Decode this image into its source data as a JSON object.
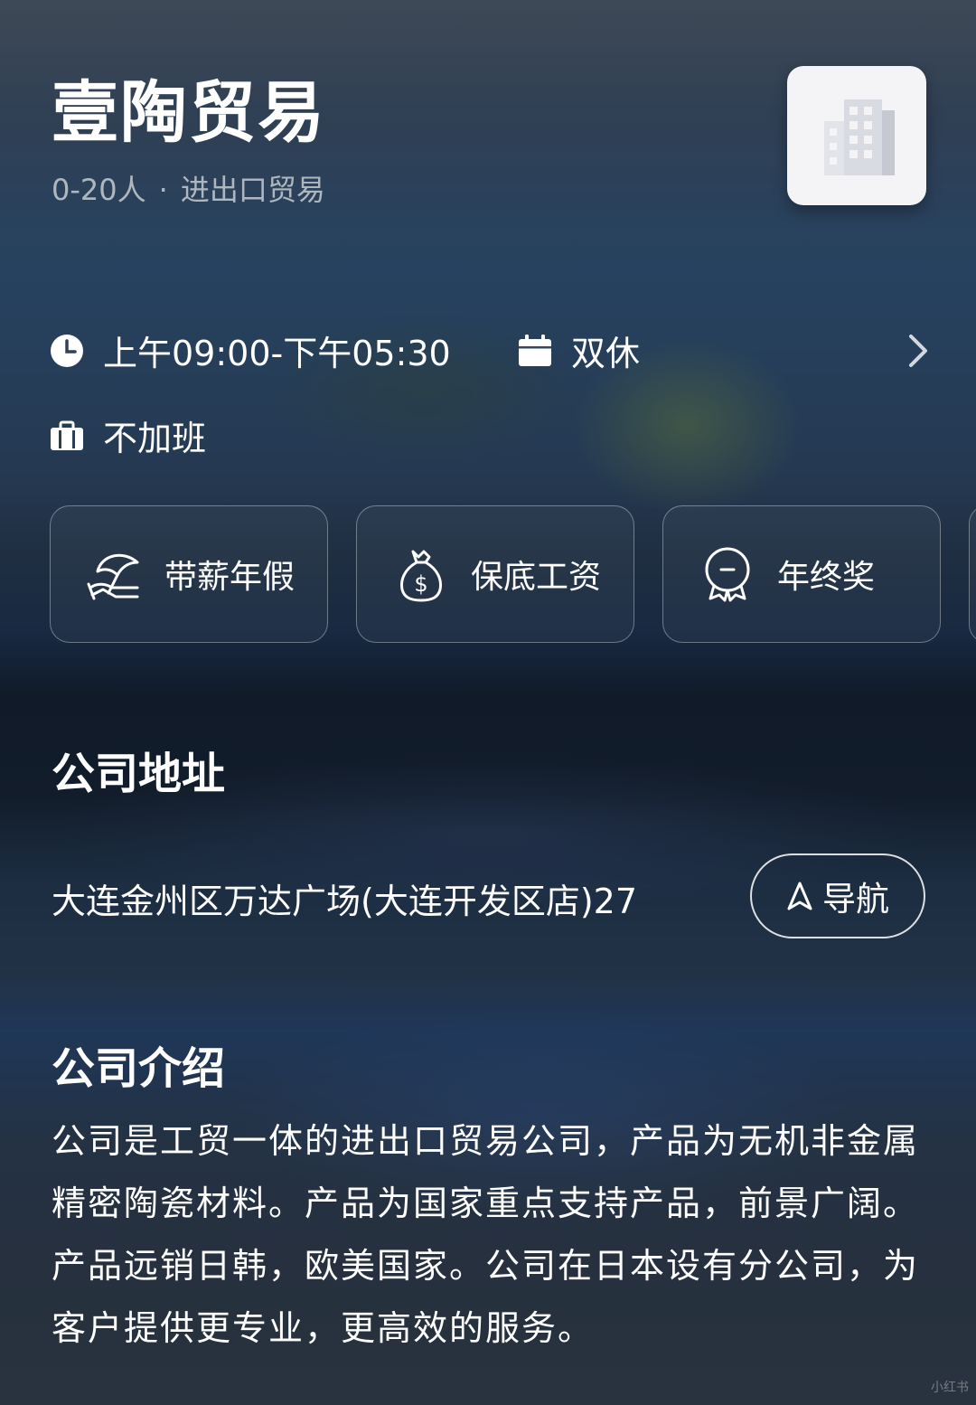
{
  "company": {
    "name": "壹陶贸易",
    "size": "0-20人",
    "separator": "·",
    "industry": "进出口贸易"
  },
  "work_info": {
    "hours": "上午09:00-下午05:30",
    "rest": "双休",
    "overtime": "不加班"
  },
  "benefits": [
    {
      "label": "带薪年假",
      "icon": "beach-umbrella-icon"
    },
    {
      "label": "保底工资",
      "icon": "money-bag-icon"
    },
    {
      "label": "年终奖",
      "icon": "medal-icon"
    }
  ],
  "address_section": {
    "title": "公司地址",
    "address": "大连金州区万达广场(大连开发区店)27",
    "nav_label": "导航"
  },
  "intro_section": {
    "title": "公司介绍",
    "text": "公司是工贸一体的进出口贸易公司，产品为无机非金属 精密陶瓷材料。产品为国家重点支持产品，前景广阔。产品远销日韩，欧美国家。公司在日本设有分公司，为客户提供更专业，更高效的服务。"
  },
  "watermark": "小红书"
}
